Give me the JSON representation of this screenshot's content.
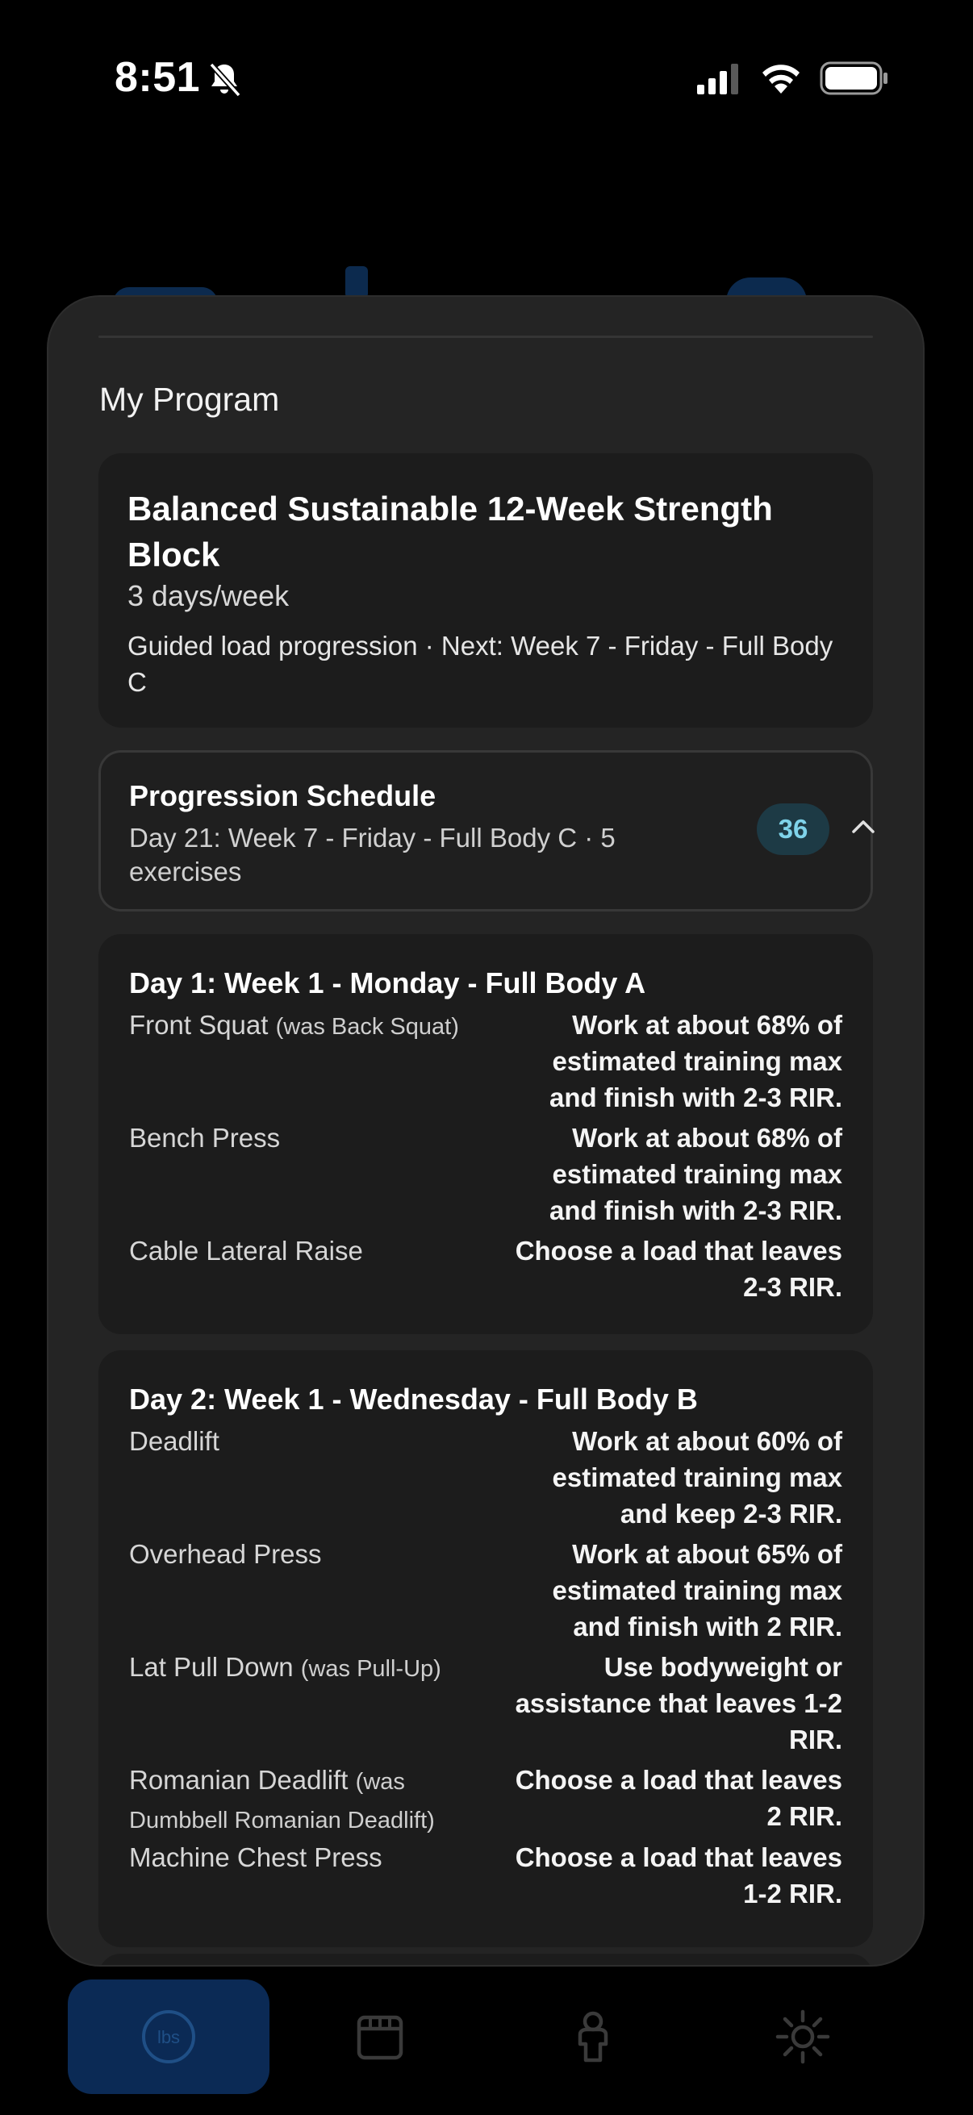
{
  "status_bar": {
    "time": "8:51",
    "icons": [
      "bell-slash-icon",
      "cellular-signal-icon",
      "wifi-icon",
      "battery-icon"
    ]
  },
  "sheet": {
    "title": "My Program",
    "program": {
      "name": "Balanced Sustainable 12-Week Strength Block",
      "frequency": "3 days/week",
      "next_line": "Guided load progression · Next: Week 7 - Friday - Full Body C"
    },
    "schedule": {
      "title": "Progression Schedule",
      "subtitle": "Day 21: Week 7 - Friday - Full Body C · 5 exercises",
      "count": "36",
      "expanded": true
    },
    "days": [
      {
        "title": "Day 1: Week 1 - Monday - Full Body A",
        "exercises": [
          {
            "name": "Front Squat",
            "was": "(was Back Squat)",
            "target": "Work at about 68% of estimated training max and finish with 2-3 RIR."
          },
          {
            "name": "Bench Press",
            "was": "",
            "target": "Work at about 68% of estimated training max and finish with 2-3 RIR."
          },
          {
            "name": "Cable Lateral Raise",
            "was": "",
            "target": "Choose a load that leaves 2-3 RIR."
          }
        ]
      },
      {
        "title": "Day 2: Week 1 - Wednesday - Full Body B",
        "exercises": [
          {
            "name": "Deadlift",
            "was": "",
            "target": "Work at about 60% of estimated training max and keep 2-3 RIR."
          },
          {
            "name": "Overhead Press",
            "was": "",
            "target": "Work at about 65% of estimated training max and finish with 2 RIR."
          },
          {
            "name": "Lat Pull Down",
            "was": "(was Pull-Up)",
            "target": "Use bodyweight or assistance that leaves 1-2 RIR."
          },
          {
            "name": "Romanian Deadlift",
            "was": "(was Dumbbell Romanian Deadlift)",
            "target": "Choose a load that leaves 2 RIR."
          },
          {
            "name": "Machine Chest Press",
            "was": "",
            "target": "Choose a load that leaves 1-2 RIR."
          }
        ]
      }
    ]
  },
  "tab_bar": {
    "tabs": [
      {
        "icon": "weight-plate-icon",
        "label": "lbs",
        "active": true
      },
      {
        "icon": "calendar-icon",
        "active": false
      },
      {
        "icon": "person-icon",
        "active": false
      },
      {
        "icon": "sun-icon",
        "active": false
      }
    ]
  },
  "colors": {
    "background": "#000000",
    "sheet": "#242424",
    "card": "#1c1c1c",
    "badge_bg": "#1d3a45",
    "badge_text": "#7fd3ea",
    "active_tab": "#0b2a55"
  }
}
